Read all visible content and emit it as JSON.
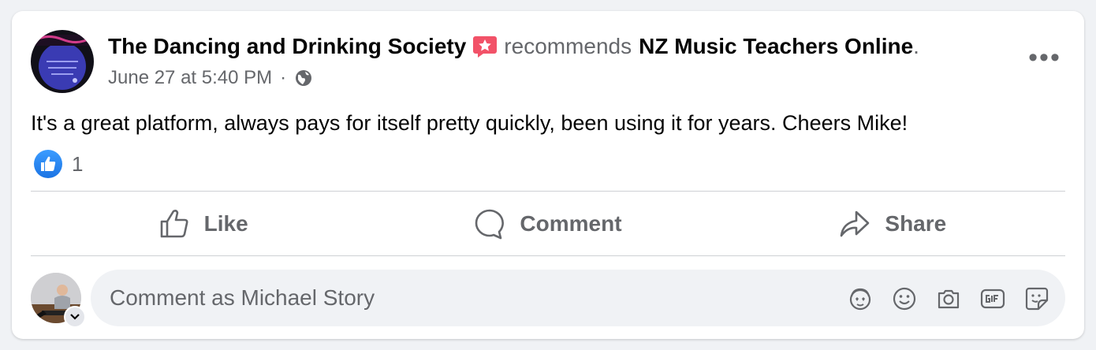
{
  "post": {
    "author": "The Dancing and Drinking Society",
    "verb": "recommends",
    "page": "NZ Music Teachers Online",
    "period": ".",
    "timestamp": "June 27 at 5:40 PM",
    "separator": "·",
    "audience_icon": "globe-icon",
    "badge_icon": "recommendation-star-icon",
    "menu_icon": "more-options-icon",
    "more_label": "•••",
    "text": "It's a great platform, always pays for itself pretty quickly, been using it for years. Cheers Mike!",
    "reaction_icon": "like-reaction-icon",
    "reaction_count": "1"
  },
  "actions": {
    "like_label": "Like",
    "comment_label": "Comment",
    "share_label": "Share"
  },
  "composer": {
    "placeholder": "Comment as Michael Story",
    "tools": [
      "avatar-sticker-icon",
      "emoji-icon",
      "camera-icon",
      "gif-icon",
      "sticker-icon"
    ]
  },
  "colors": {
    "accent": "#1b74e4",
    "badge": "#f25268",
    "muted": "#65676b",
    "background": "#f0f2f5"
  }
}
